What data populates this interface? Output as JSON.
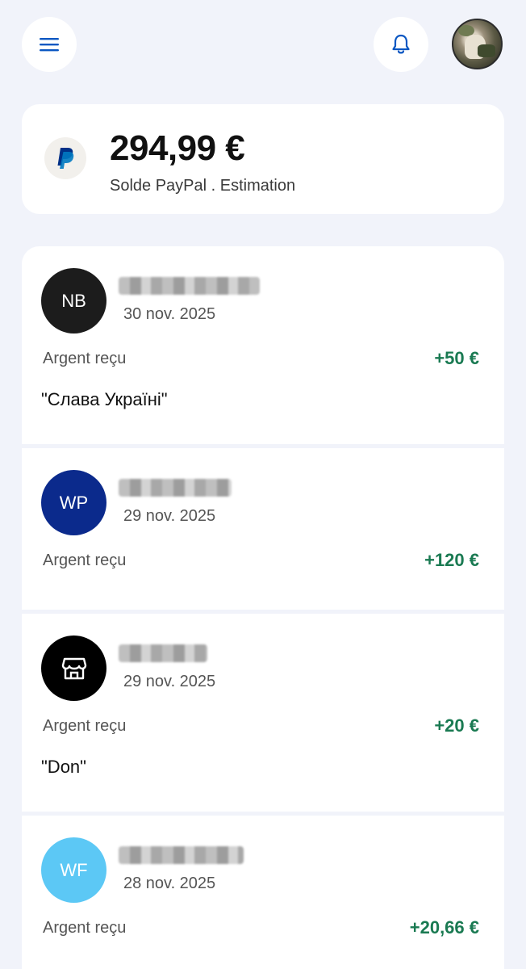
{
  "header": {
    "menu_icon": "hamburger-menu-icon",
    "bell_icon": "bell-icon",
    "avatar": "profile-avatar"
  },
  "balance": {
    "amount": "294,99 €",
    "label": "Solde PayPal . Estimation",
    "logo_icon": "paypal-logo-icon"
  },
  "colors": {
    "background": "#f1f3fa",
    "card": "#ffffff",
    "positive_amount": "#1a7a52",
    "icon_blue": "#0a57c2"
  },
  "transactions": [
    {
      "initials": "NB",
      "avatar_color": "#1c1c1c",
      "date": "30 nov. 2025",
      "type": "Argent reçu",
      "amount": "+50 €",
      "note": "\"Слава Україні\""
    },
    {
      "initials": "WP",
      "avatar_color": "#0b2a8c",
      "date": "29 nov. 2025",
      "type": "Argent reçu",
      "amount": "+120 €",
      "note": ""
    },
    {
      "initials": "",
      "avatar_icon": "store-icon",
      "avatar_color": "#000000",
      "date": "29 nov. 2025",
      "type": "Argent reçu",
      "amount": "+20 €",
      "note": "\"Don\""
    },
    {
      "initials": "WF",
      "avatar_color": "#5cc8f5",
      "date": "28 nov. 2025",
      "type": "Argent reçu",
      "amount": "+20,66 €",
      "note": ""
    }
  ]
}
